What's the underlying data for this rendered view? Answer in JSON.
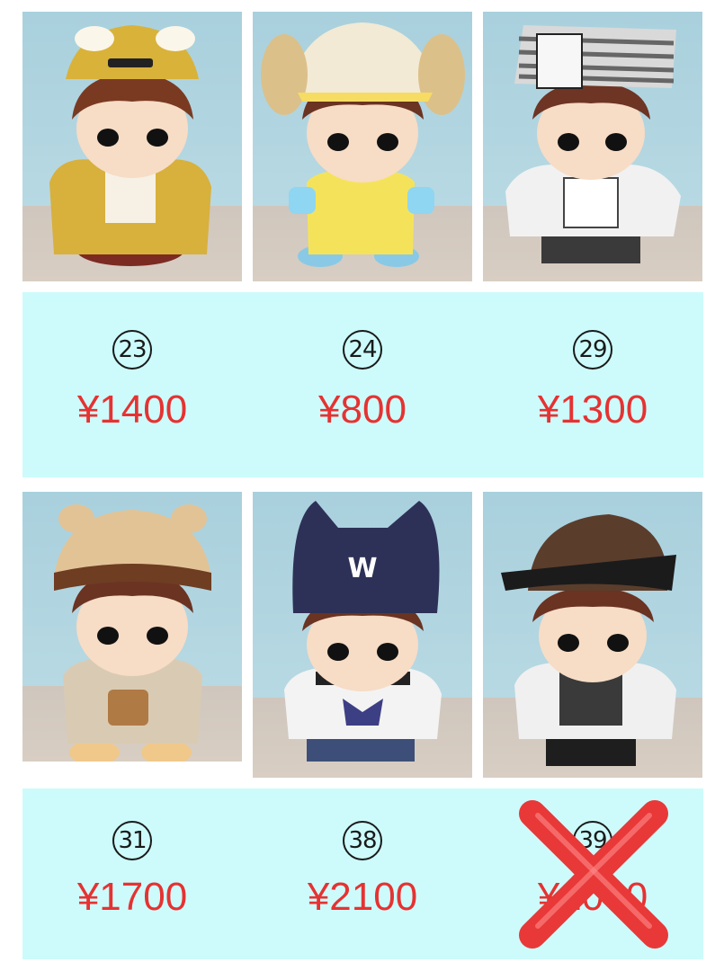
{
  "items": [
    {
      "number": "23",
      "price": "¥1400",
      "hat": "#d9b23a",
      "outfit": "#d8b03c",
      "available": true
    },
    {
      "number": "24",
      "price": "¥800",
      "hat": "#f2ead4",
      "outfit": "#f4e35a",
      "available": true
    },
    {
      "number": "29",
      "price": "¥1300",
      "hat": "#9a9a9a",
      "outfit": "#f1f1f1",
      "available": true
    },
    {
      "number": "31",
      "price": "¥1700",
      "hat": "#e2c396",
      "outfit": "#d9cbb3",
      "available": true
    },
    {
      "number": "38",
      "price": "¥2100",
      "hat": "#2d3157",
      "outfit": "#f3f3f3",
      "available": true
    },
    {
      "number": "39",
      "price": "¥2000",
      "hat": "#5b3d2c",
      "outfit": "#3a3a3a",
      "available": false
    }
  ],
  "colors": {
    "band": "#cdfbfb",
    "price": "#e63232",
    "cross": "#e83838"
  }
}
